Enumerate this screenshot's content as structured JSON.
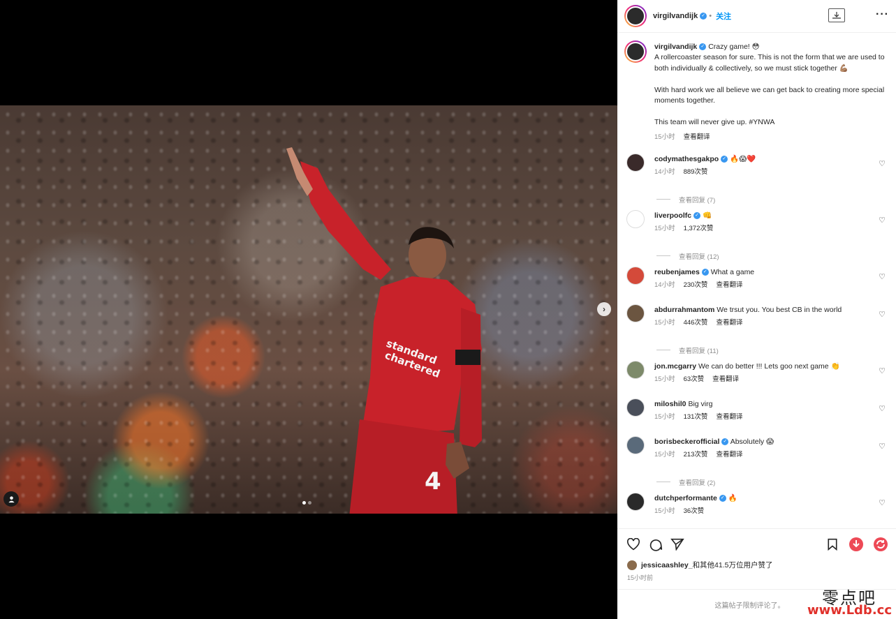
{
  "post": {
    "username": "virgilvandijk",
    "follow_label": "关注",
    "caption_title": "Crazy game! 😳",
    "caption_body": "A rollercoaster season for sure. This is not the form that we are used to both individually & collectively, so we must stick together 💪🏽\n\nWith hard work we all believe we can get back to creating more special moments together.\n\nThis team will never give up. #YNWA",
    "caption_time": "15小时",
    "translate_label": "查看翻译"
  },
  "comments": [
    {
      "user": "codymathesgakpo",
      "verified": true,
      "text": "🔥😱❤️",
      "time": "14小时",
      "likes": "889次赞",
      "replies": "查看回复 (7)",
      "avatar_color": "#3a2a2a"
    },
    {
      "user": "liverpoolfc",
      "verified": true,
      "text": "👊",
      "time": "15小时",
      "likes": "1,372次赞",
      "replies": "查看回复 (12)",
      "avatar_color": "#ffffff"
    },
    {
      "user": "reubenjames",
      "verified": true,
      "text": "What a game",
      "time": "14小时",
      "likes": "230次赞",
      "translate": "查看翻译",
      "avatar_color": "#d44a3a"
    },
    {
      "user": "abdurrahmantom",
      "verified": false,
      "text": "We trsut you. You best CB in the world",
      "time": "15小时",
      "likes": "446次赞",
      "translate": "查看翻译",
      "replies": "查看回复 (11)",
      "avatar_color": "#6b5540"
    },
    {
      "user": "jon.mcgarry",
      "verified": false,
      "text": "We can do better !!! Lets goo next game 👏",
      "time": "15小时",
      "likes": "63次赞",
      "translate": "查看翻译",
      "avatar_color": "#7d8a6a"
    },
    {
      "user": "miloshil0",
      "verified": false,
      "text": "Big virg",
      "time": "15小时",
      "likes": "131次赞",
      "translate": "查看翻译",
      "avatar_color": "#4a4f5a"
    },
    {
      "user": "borisbeckerofficial",
      "verified": true,
      "text": "Absolutely 😱",
      "time": "15小时",
      "likes": "213次赞",
      "translate": "查看翻译",
      "replies": "查看回复 (2)",
      "avatar_color": "#5a6a7a"
    },
    {
      "user": "dutchperformante",
      "verified": true,
      "text": "🔥",
      "time": "15小时",
      "likes": "36次赞",
      "avatar_color": "#2a2a2a"
    }
  ],
  "liked_by": {
    "user": "jessicaashley_",
    "text": "和其他41.5万位用户赞了",
    "time": "15小时前"
  },
  "restricted_text": "这篇帖子限制评论了。",
  "watermark": {
    "line1": "零点吧",
    "line2": "www.Ldb.cc"
  },
  "colors": {
    "link": "#0095f6",
    "verified": "#3897f0",
    "download": "#ed4956",
    "share": "#ed4956"
  },
  "carousel": {
    "current": 1,
    "total": 2
  }
}
